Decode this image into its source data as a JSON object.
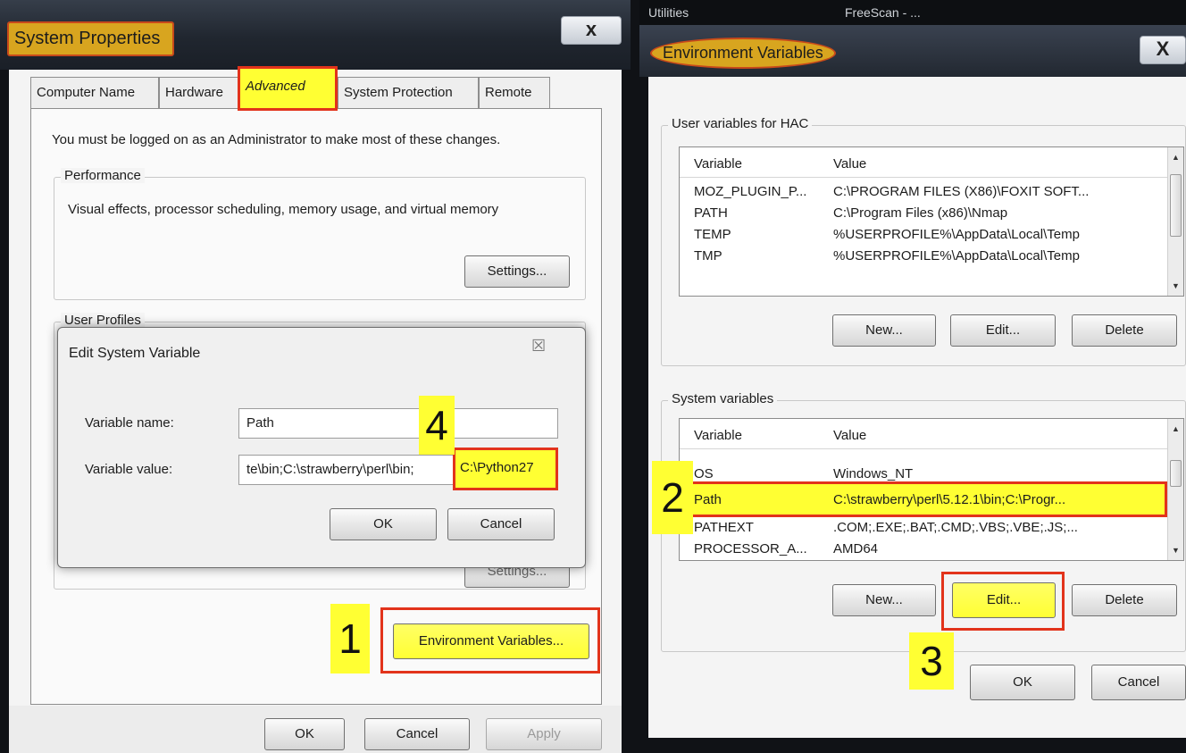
{
  "system_properties": {
    "title": "System Properties",
    "close_glyph": "x",
    "tabs": [
      {
        "label": "Computer Name"
      },
      {
        "label": "Hardware"
      },
      {
        "label": "Advanced"
      },
      {
        "label": "System Protection"
      },
      {
        "label": "Remote"
      }
    ],
    "active_tab": "Advanced",
    "admin_note": "You must be logged on as an Administrator to make most of these changes.",
    "performance": {
      "heading": "Performance",
      "description": "Visual effects, processor scheduling, memory usage, and virtual memory",
      "settings_button": "Settings..."
    },
    "user_profiles_heading": "User Profiles",
    "env_vars_button": "Environment Variables...",
    "footer": {
      "ok": "OK",
      "cancel": "Cancel",
      "apply": "Apply"
    }
  },
  "edit_dialog": {
    "title": "Edit System Variable",
    "close_glyph": "☒",
    "name_label": "Variable name:",
    "name_value": "Path",
    "value_label": "Variable value:",
    "value_text": "te\\bin;C:\\strawberry\\perl\\bin;",
    "value_highlight": "C:\\Python27",
    "ok": "OK",
    "cancel": "Cancel"
  },
  "environment_variables": {
    "top_strip": {
      "left": "Utilities",
      "right": "FreeScan - ..."
    },
    "title": "Environment Variables",
    "close_glyph": "X",
    "user_vars": {
      "heading": "User variables for HAC",
      "columns": [
        "Variable",
        "Value"
      ],
      "rows": [
        {
          "variable": "MOZ_PLUGIN_P...",
          "value": "C:\\PROGRAM FILES (X86)\\FOXIT SOFT..."
        },
        {
          "variable": "PATH",
          "value": "C:\\Program Files (x86)\\Nmap"
        },
        {
          "variable": "TEMP",
          "value": "%USERPROFILE%\\AppData\\Local\\Temp"
        },
        {
          "variable": "TMP",
          "value": "%USERPROFILE%\\AppData\\Local\\Temp"
        }
      ],
      "buttons": {
        "new": "New...",
        "edit": "Edit...",
        "delete": "Delete"
      }
    },
    "system_vars": {
      "heading": "System variables",
      "columns": [
        "Variable",
        "Value"
      ],
      "rows": [
        {
          "variable": "OS",
          "value": "Windows_NT"
        },
        {
          "variable": "Path",
          "value": "C:\\strawberry\\perl\\5.12.1\\bin;C:\\Progr..."
        },
        {
          "variable": "PATHEXT",
          "value": ".COM;.EXE;.BAT;.CMD;.VBS;.VBE;.JS;..."
        },
        {
          "variable": "PROCESSOR_A...",
          "value": "AMD64"
        }
      ],
      "selected_variable": "Path",
      "buttons": {
        "new": "New...",
        "edit": "Edit...",
        "delete": "Delete"
      }
    },
    "footer": {
      "ok": "OK",
      "cancel": "Cancel"
    }
  },
  "steps": {
    "s1": "1",
    "s2": "2",
    "s3": "3",
    "s4": "4"
  }
}
